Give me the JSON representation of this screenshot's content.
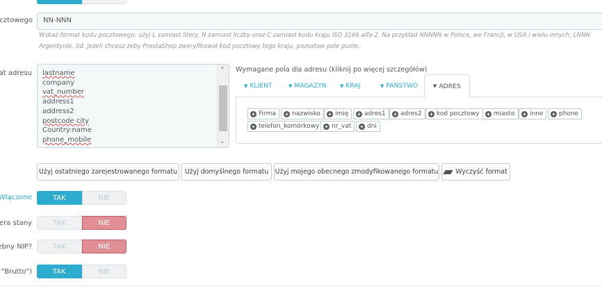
{
  "postcode": {
    "label": "pocztowego",
    "value": "NN-NNN",
    "help_line1": "Wskaż format kodu pocztowego: użyj L zamiast litery, N zamiast liczby oraz C zamiast kodu kraju ISO 3166 alfa-2. Na przykład NNNNN w Polsce, we Francji, w USA i wielu innych; LNNN",
    "help_line2": "Argentynie, itd. Jeżeli chcesz żeby PrestaShop zweryfikował kod pocztowy tego kraju, pozostaw pole puste."
  },
  "address_format": {
    "label": "at adresu",
    "lines": [
      "lastname",
      "company",
      "vat_number",
      "address1",
      "address2",
      "postcode city",
      "Country:name",
      "phone_mobile"
    ]
  },
  "required_fields": {
    "title": "Wymagane pola dla adresu (kliknij po więcej szczegółów)",
    "tabs": [
      "KLIENT",
      "MAGAZYN",
      "KRAJ",
      "PAŃSTWO",
      "ADRES"
    ],
    "active_tab": "ADRES",
    "chips": [
      "Firma",
      "nazwisko",
      "imię",
      "adres1",
      "adres2",
      "kod pocztowy",
      "miasto",
      "inne",
      "phone",
      "telefon_komórkowy",
      "nr_vat",
      "dni"
    ]
  },
  "buttons": {
    "last_format": "Użyj ostatniego zarejestrowanego formatu",
    "default_format": "Użyj domyślnego formatu",
    "current_format": "Użyj mojego obecnego zmodyfikowanego formatu",
    "clear_format": "Wyczyść format"
  },
  "toggles": [
    {
      "label": "Włączone",
      "yes": "TAK",
      "no": "NIE",
      "value": "yes"
    },
    {
      "label": "dera stany",
      "yes": "TAK",
      "no": "NIE",
      "value": "no"
    },
    {
      "label": "ebny NIP?",
      "yes": "TAK",
      "no": "NIE",
      "value": "no"
    },
    {
      "label": "\"Brutto\")",
      "yes": "TAK",
      "no": "NIE",
      "value": "yes"
    }
  ],
  "colors": {
    "accent": "#2eacce",
    "danger": "#e08f95"
  }
}
